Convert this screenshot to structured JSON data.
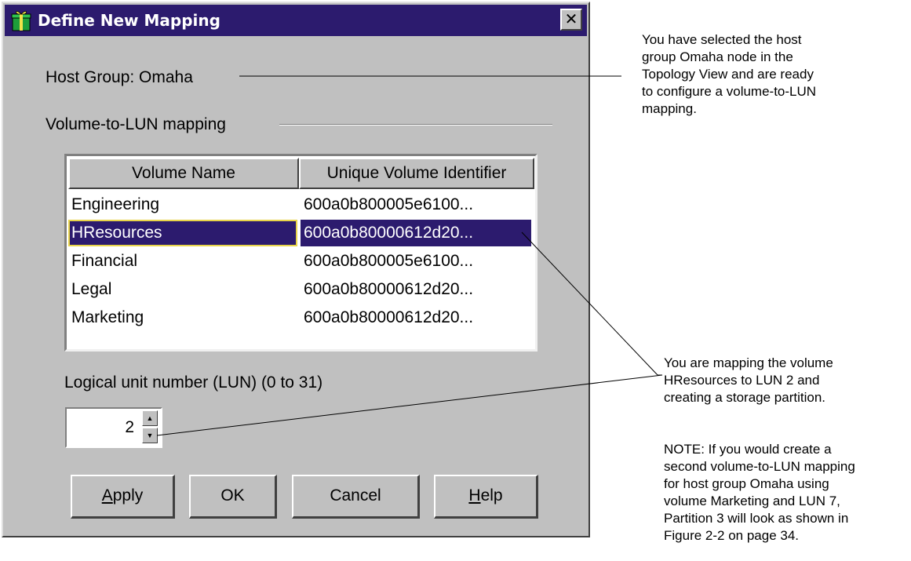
{
  "dialog": {
    "title": "Define New Mapping",
    "host_group_label": "Host Group: Omaha",
    "mapping_section_label": "Volume-to-LUN mapping",
    "table": {
      "columns": [
        "Volume Name",
        "Unique Volume Identifier"
      ],
      "rows": [
        {
          "name": "Engineering",
          "id": "600a0b800005e6100..."
        },
        {
          "name": "HResources",
          "id": "600a0b80000612d20...",
          "selected": true
        },
        {
          "name": "Financial",
          "id": "600a0b800005e6100..."
        },
        {
          "name": "Legal",
          "id": "600a0b80000612d20..."
        },
        {
          "name": "Marketing",
          "id": "600a0b80000612d20..."
        }
      ]
    },
    "lun_label": "Logical unit number (LUN) (0 to 31)",
    "lun_value": "2",
    "buttons": {
      "apply_pre": "",
      "apply_mnemonic": "A",
      "apply_post": "pply",
      "ok": "OK",
      "cancel": "Cancel",
      "help_pre": "",
      "help_mnemonic": "H",
      "help_post": "elp"
    },
    "colors": {
      "titlebar": "#2c1b6e",
      "face": "#c0c0c0",
      "selection": "#2c1b6e",
      "focus": "#e8d44a"
    },
    "icons": {
      "title": "gift-box-icon",
      "close": "close-x-icon"
    }
  },
  "annotations": {
    "note1": [
      "You have selected the host",
      "group Omaha node in the",
      "Topology View and are ready",
      "to configure a volume-to-LUN",
      "mapping."
    ],
    "note2": [
      "You are mapping the volume",
      "HResources to LUN 2 and",
      "creating a storage partition."
    ],
    "note3": [
      "NOTE: If you would create a",
      "second volume-to-LUN mapping",
      "for host group Omaha using",
      "volume Marketing and LUN 7,",
      "Partition 3 will look as shown in",
      "Figure 2-2 on page 34."
    ]
  }
}
